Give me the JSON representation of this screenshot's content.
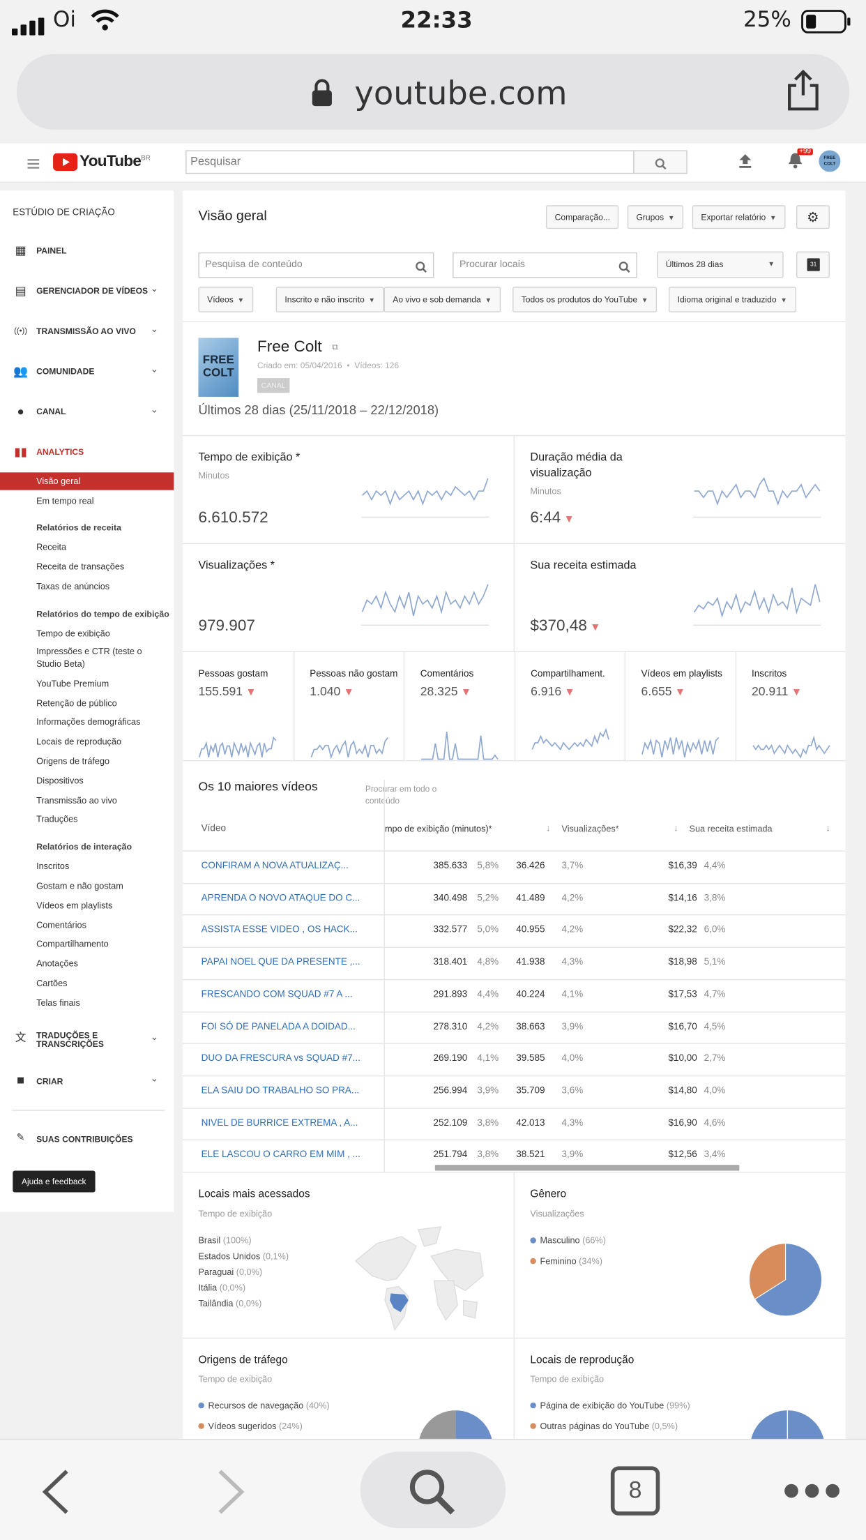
{
  "status_bar": {
    "carrier": "Oi",
    "time": "22:33",
    "battery": "25%"
  },
  "browser": {
    "url": "youtube.com",
    "tab_count": "8"
  },
  "yt_header": {
    "logo": "YouTube",
    "region": "BR",
    "search_placeholder": "Pesquisar",
    "notifications": "+99",
    "avatar_text": "FREE COLT"
  },
  "sidebar": {
    "title": "ESTÚDIO DE CRIAÇÃO",
    "sections": [
      {
        "label": "PAINEL",
        "icon": "dashboard-icon"
      },
      {
        "label": "GERENCIADOR DE VÍDEOS",
        "icon": "video-manager-icon"
      },
      {
        "label": "TRANSMISSÃO AO VIVO",
        "icon": "live-icon"
      },
      {
        "label": "COMUNIDADE",
        "icon": "community-icon"
      },
      {
        "label": "CANAL",
        "icon": "channel-icon"
      },
      {
        "label": "ANALYTICS",
        "icon": "analytics-icon"
      }
    ],
    "analytics_items": [
      "Visão geral",
      "Em tempo real"
    ],
    "revenue_group": "Relatórios de receita",
    "revenue_items": [
      "Receita",
      "Receita de transações",
      "Taxas de anúncios"
    ],
    "watch_group": "Relatórios do tempo de exibição",
    "watch_items": [
      "Tempo de exibição",
      "Impressões e CTR (teste o",
      "Studio Beta)",
      "YouTube Premium",
      "Retenção de público",
      "Informações demográficas",
      "Locais de reprodução",
      "Origens de tráfego",
      "Dispositivos",
      "Transmissão ao vivo",
      "Traduções"
    ],
    "interaction_group": "Relatórios de interação",
    "interaction_items": [
      "Inscritos",
      "Gostam e não gostam",
      "Vídeos em playlists",
      "Comentários",
      "Compartilhamento",
      "Anotações",
      "Cartões",
      "Telas finais"
    ],
    "translations": [
      "TRADUÇÕES E",
      "TRANSCRIÇÕES"
    ],
    "create": "CRIAR",
    "contributions": "SUAS CONTRIBUIÇÕES",
    "help": "Ajuda e feedback"
  },
  "toolbar": {
    "title": "Visão geral",
    "compare": "Comparação...",
    "groups": "Grupos",
    "export": "Exportar relatório",
    "content_search": "Pesquisa de conteúdo",
    "location_search": "Procurar locais",
    "date_range": "Últimos 28 dias",
    "calendar_day": "31",
    "filters": [
      "Vídeos",
      "Inscrito e não inscrito",
      "Ao vivo e sob demanda",
      "Todos os produtos do YouTube",
      "Idioma original e traduzido"
    ]
  },
  "channel": {
    "name": "Free Colt",
    "thumb_text": "FREE COLT",
    "created": "Criado em: 05/04/2016",
    "videos": "Vídeos: 126",
    "badge": "CANAL",
    "period": "Últimos 28 dias (25/11/2018 – 22/12/2018)"
  },
  "metrics": [
    {
      "title": "Tempo de exibição *",
      "sub": "Minutos",
      "value": "6.610.572",
      "trend": "",
      "spark": [
        5,
        6,
        4,
        6,
        5,
        6,
        3,
        6,
        4,
        5,
        6,
        4,
        6,
        3,
        6,
        5,
        6,
        4,
        6,
        5,
        7,
        6,
        5,
        6,
        4,
        6,
        6,
        9
      ]
    },
    {
      "title": "Duração média da",
      "title2": "visualização",
      "sub": "Minutos",
      "value": "6:44",
      "trend": "down",
      "spark": [
        6,
        6,
        5,
        6,
        6,
        4,
        6,
        5,
        6,
        7,
        5,
        6,
        6,
        5,
        7,
        8,
        6,
        6,
        4,
        6,
        5,
        6,
        6,
        7,
        5,
        6,
        7,
        6
      ]
    },
    {
      "title": "Visualizações *",
      "sub": "",
      "value": "979.907",
      "trend": "",
      "spark": [
        4,
        7,
        6,
        8,
        5,
        9,
        6,
        4,
        8,
        5,
        9,
        3,
        8,
        6,
        7,
        5,
        8,
        4,
        9,
        6,
        7,
        5,
        8,
        6,
        9,
        6,
        8,
        11
      ]
    },
    {
      "title": "Sua receita estimada",
      "sub": "",
      "value": "$370,48",
      "trend": "down",
      "spark": [
        3,
        5,
        4,
        6,
        5,
        7,
        2,
        6,
        4,
        8,
        3,
        6,
        5,
        9,
        4,
        7,
        3,
        8,
        5,
        6,
        4,
        10,
        3,
        7,
        6,
        5,
        11,
        6
      ]
    }
  ],
  "small_metrics": [
    {
      "title": "Pessoas gostam",
      "value": "155.591",
      "spark": [
        3,
        6,
        6,
        8,
        3,
        7,
        5,
        8,
        3,
        7,
        8,
        4,
        7,
        7,
        3,
        8,
        6,
        4,
        8,
        5,
        7,
        3,
        8,
        6,
        4,
        7,
        8,
        3,
        8,
        5,
        6,
        6,
        10,
        9
      ]
    },
    {
      "title": "Pessoas não gostam",
      "value": "1.040",
      "spark": [
        3,
        5,
        5,
        6,
        5,
        6,
        6,
        3,
        5,
        6,
        4,
        6,
        7,
        3,
        6,
        7,
        4,
        5,
        4,
        6,
        3,
        6,
        6,
        4,
        5,
        4,
        7,
        8
      ]
    },
    {
      "title": "Comentários",
      "value": "28.325",
      "spark": [
        1,
        1,
        1,
        1,
        1,
        5,
        1,
        1,
        1,
        8,
        1,
        1,
        5,
        1,
        1,
        1,
        1,
        1,
        1,
        1,
        1,
        7,
        1,
        1,
        1,
        1,
        2,
        1
      ]
    },
    {
      "title": "Compartilhament.",
      "value": "6.916",
      "spark": [
        3,
        5,
        5,
        7,
        5,
        6,
        5,
        4,
        5,
        4,
        3,
        5,
        4,
        3,
        4,
        5,
        4,
        5,
        4,
        6,
        5,
        4,
        7,
        5,
        8,
        7,
        9,
        6
      ]
    },
    {
      "title": "Vídeos em playlists",
      "value": "6.655",
      "spark": [
        3,
        7,
        5,
        8,
        3,
        8,
        7,
        2,
        8,
        5,
        9,
        3,
        9,
        5,
        8,
        2,
        7,
        4,
        7,
        5,
        8,
        3,
        8,
        4,
        8,
        3,
        8,
        9
      ]
    },
    {
      "title": "Inscritos",
      "value": "20.911",
      "spark": [
        6,
        5,
        6,
        5,
        5,
        6,
        5,
        6,
        4,
        5,
        6,
        5,
        4,
        6,
        5,
        4,
        5,
        4,
        3,
        5,
        4,
        6,
        6,
        8,
        5,
        6,
        5,
        4,
        5,
        6
      ]
    }
  ],
  "top_videos": {
    "title": "Os 10 maiores vídeos",
    "search_all": [
      "Procurar em todo o",
      "conteúdo"
    ],
    "columns": [
      "Vídeo",
      "mpo de exibição (minutos)*",
      "Visualizações*",
      "Sua receita estimada"
    ],
    "rows": [
      {
        "video": "CONFIRAM A NOVA ATUALIZAÇ...",
        "watch": "385.633",
        "watch_pct": "5,8%",
        "views": "36.426",
        "views_pct": "3,7%",
        "revenue": "$16,39",
        "revenue_pct": "4,4%"
      },
      {
        "video": "APRENDA O NOVO ATAQUE DO C...",
        "watch": "340.498",
        "watch_pct": "5,2%",
        "views": "41.489",
        "views_pct": "4,2%",
        "revenue": "$14,16",
        "revenue_pct": "3,8%"
      },
      {
        "video": "ASSISTA ESSE VIDEO , OS HACK...",
        "watch": "332.577",
        "watch_pct": "5,0%",
        "views": "40.955",
        "views_pct": "4,2%",
        "revenue": "$22,32",
        "revenue_pct": "6,0%"
      },
      {
        "video": "PAPAI NOEL QUE DA PRESENTE ,...",
        "watch": "318.401",
        "watch_pct": "4,8%",
        "views": "41.938",
        "views_pct": "4,3%",
        "revenue": "$18,98",
        "revenue_pct": "5,1%"
      },
      {
        "video": "FRESCANDO COM SQUAD #7 A ...",
        "watch": "291.893",
        "watch_pct": "4,4%",
        "views": "40.224",
        "views_pct": "4,1%",
        "revenue": "$17,53",
        "revenue_pct": "4,7%"
      },
      {
        "video": "FOI SÓ DE PANELADA A DOIDAD...",
        "watch": "278.310",
        "watch_pct": "4,2%",
        "views": "38.663",
        "views_pct": "3,9%",
        "revenue": "$16,70",
        "revenue_pct": "4,5%"
      },
      {
        "video": "DUO DA FRESCURA vs SQUAD #7...",
        "watch": "269.190",
        "watch_pct": "4,1%",
        "views": "39.585",
        "views_pct": "4,0%",
        "revenue": "$10,00",
        "revenue_pct": "2,7%"
      },
      {
        "video": "ELA SAIU DO TRABALHO SO PRA...",
        "watch": "256.994",
        "watch_pct": "3,9%",
        "views": "35.709",
        "views_pct": "3,6%",
        "revenue": "$14,80",
        "revenue_pct": "4,0%"
      },
      {
        "video": "NIVEL DE BURRICE EXTREMA , A...",
        "watch": "252.109",
        "watch_pct": "3,8%",
        "views": "42.013",
        "views_pct": "4,3%",
        "revenue": "$16,90",
        "revenue_pct": "4,6%"
      },
      {
        "video": "ELE LASCOU O CARRO EM MIM , ...",
        "watch": "251.794",
        "watch_pct": "3,8%",
        "views": "38.521",
        "views_pct": "3,9%",
        "revenue": "$12,56",
        "revenue_pct": "3,4%"
      }
    ]
  },
  "locations": {
    "title": "Locais mais acessados",
    "sub": "Tempo de exibição",
    "items": [
      {
        "name": "Brasil",
        "pct": "(100%)"
      },
      {
        "name": "Estados Unidos",
        "pct": "(0,1%)"
      },
      {
        "name": "Paraguai",
        "pct": "(0,0%)"
      },
      {
        "name": "Itália",
        "pct": "(0,0%)"
      },
      {
        "name": "Tailândia",
        "pct": "(0,0%)"
      }
    ]
  },
  "gender": {
    "title": "Gênero",
    "sub": "Visualizações",
    "items": [
      {
        "name": "Masculino",
        "pct": "(66%)",
        "value": 66,
        "color": "#6a8fc8"
      },
      {
        "name": "Feminino",
        "pct": "(34%)",
        "value": 34,
        "color": "#d98c5b"
      }
    ]
  },
  "traffic": {
    "title": "Origens de tráfego",
    "sub": "Tempo de exibição",
    "items": [
      {
        "name": "Recursos de navegação",
        "pct": "(40%)",
        "color": "#6a8fc8"
      },
      {
        "name": "Vídeos sugeridos",
        "pct": "(24%)",
        "color": "#d98c5b"
      }
    ]
  },
  "playback": {
    "title": "Locais de reprodução",
    "sub": "Tempo de exibição",
    "items": [
      {
        "name": "Página de exibição do YouTube",
        "pct": "(99%)",
        "color": "#6a8fc8"
      },
      {
        "name": "Outras páginas do YouTube",
        "pct": "(0,5%)",
        "color": "#d98c5b"
      }
    ]
  },
  "colors": {
    "accent_red": "#c4302b",
    "link_blue": "#2f6db5",
    "spark_blue": "#8fa8d0",
    "down_red": "#e57373"
  }
}
